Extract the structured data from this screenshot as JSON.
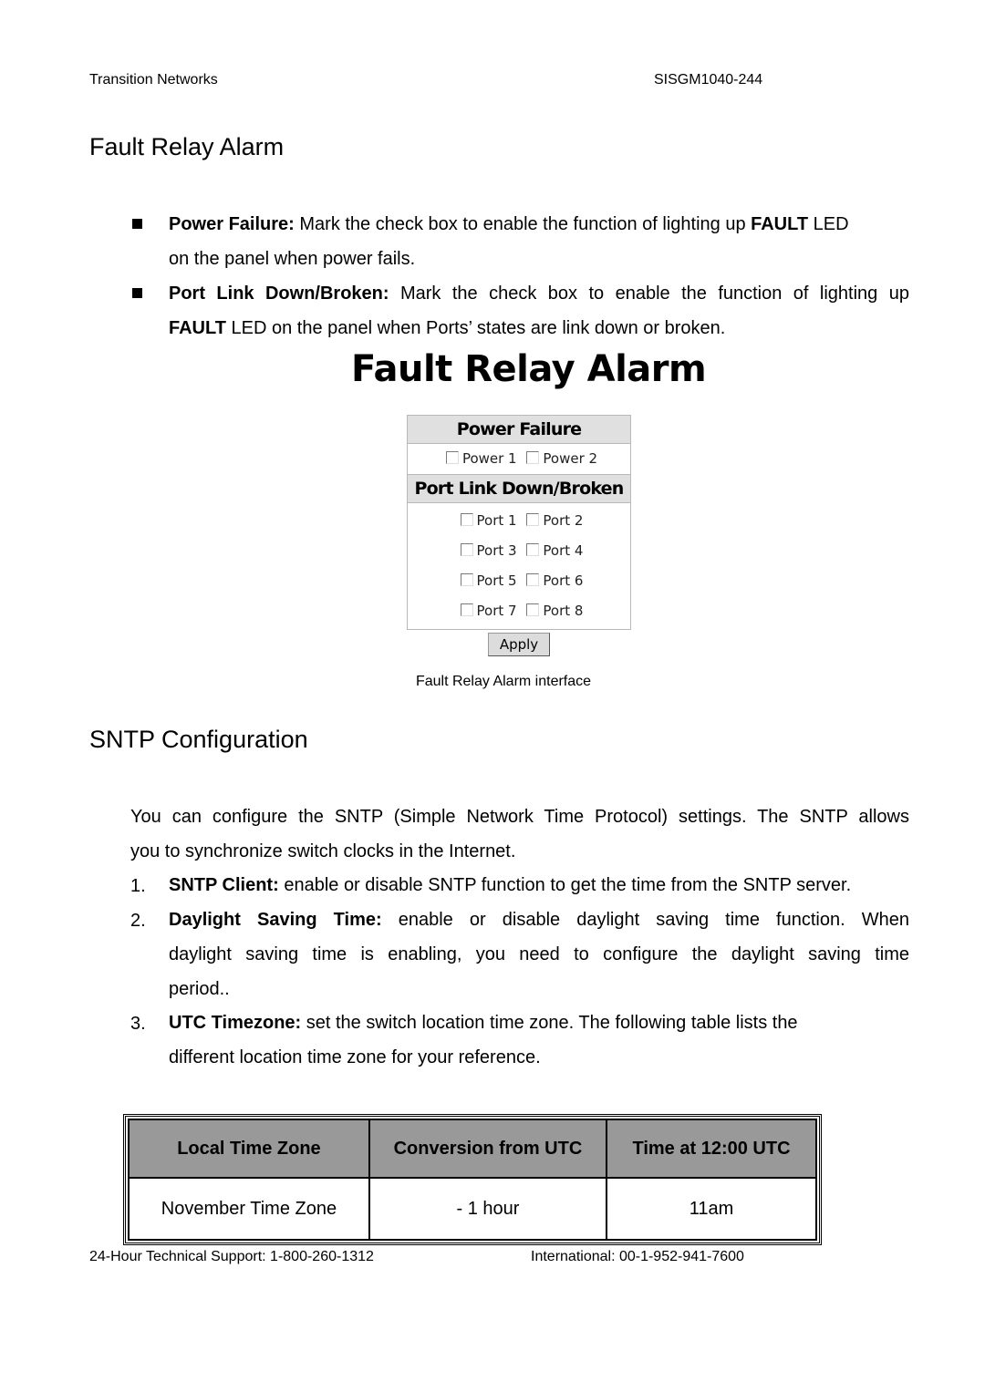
{
  "header": {
    "left": "Transition Networks",
    "right": "SISGM1040-244"
  },
  "section1": {
    "title": "Fault Relay Alarm",
    "bullets": [
      {
        "term": "Power Failure:",
        "text_before": " Mark the check box to enable the function of lighting up ",
        "bold": "FAULT",
        "text_after": " LED",
        "line2": "on the panel when power fails."
      },
      {
        "term": "Port Link Down/Broken:",
        "text_before": " Mark the check box to enable the function of lighting up",
        "line2_bold": "FAULT",
        "line2": " LED on the panel when Ports’ states are link down or broken."
      }
    ],
    "widget": {
      "title": "Fault Relay Alarm",
      "power_header": "Power Failure",
      "power_items": [
        "Power 1",
        "Power 2"
      ],
      "port_header": "Port Link Down/Broken",
      "port_items": [
        "Port 1",
        "Port 2",
        "Port 3",
        "Port 4",
        "Port 5",
        "Port 6",
        "Port 7",
        "Port 8"
      ],
      "apply_label": "Apply"
    },
    "caption": "Fault Relay Alarm interface"
  },
  "section2": {
    "title": "SNTP Configuration",
    "intro_line1": "You can configure the SNTP (Simple Network Time Protocol) settings. The SNTP allows",
    "intro_line2": "you to synchronize switch clocks in the Internet.",
    "items": [
      {
        "num": "1.",
        "term": "SNTP Client:",
        "text": " enable or disable SNTP function to get the time from the SNTP server."
      },
      {
        "num": "2.",
        "term": "Daylight Saving Time:",
        "text": " enable or disable daylight saving time function. When",
        "line2": "daylight saving time is enabling, you need to configure the daylight saving time",
        "line3": "period.."
      },
      {
        "num": "3.",
        "term": "UTC Timezone:",
        "text": " set the switch location time zone. The following table lists the",
        "line2": "different location time zone for your reference."
      }
    ],
    "table": {
      "headers": [
        "Local Time Zone",
        "Conversion from UTC",
        "Time at 12:00 UTC"
      ],
      "rows": [
        [
          "November Time Zone",
          "- 1 hour",
          "11am"
        ]
      ]
    }
  },
  "footer": {
    "left": "24-Hour Technical Support: 1-800-260-1312",
    "right": "International: 00-1-952-941-7600"
  }
}
